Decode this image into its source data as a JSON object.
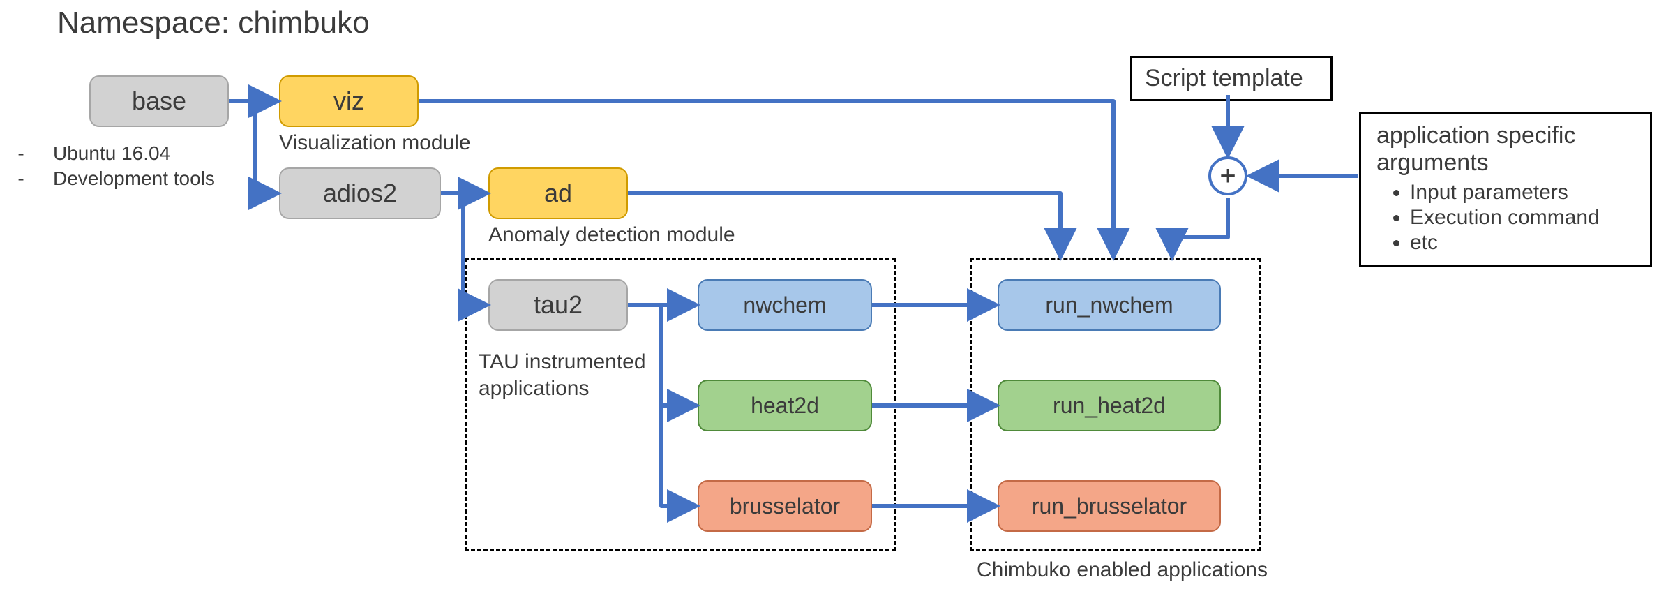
{
  "title": "Namespace: chimbuko",
  "side_notes": [
    "Ubuntu 16.04",
    "Development tools"
  ],
  "nodes": {
    "base": {
      "label": "base"
    },
    "viz": {
      "label": "viz",
      "caption": "Visualization module"
    },
    "adios2": {
      "label": "adios2"
    },
    "ad": {
      "label": "ad",
      "caption": "Anomaly detection module"
    },
    "tau2": {
      "label": "tau2"
    },
    "nwchem": {
      "label": "nwchem"
    },
    "heat2d": {
      "label": "heat2d"
    },
    "brusselator": {
      "label": "brusselator"
    },
    "run_nwchem": {
      "label": "run_nwchem"
    },
    "run_heat2d": {
      "label": "run_heat2d"
    },
    "run_brusselator": {
      "label": "run_brusselator"
    }
  },
  "groups": {
    "tau_apps": "TAU instrumented applications",
    "chimbuko_apps": "Chimbuko enabled applications"
  },
  "script_template": "Script template",
  "args_box": {
    "title": "application specific arguments",
    "items": [
      "Input parameters",
      "Execution command",
      "etc"
    ]
  },
  "plus_symbol": "+",
  "colors": {
    "arrow": "#4472c4"
  }
}
